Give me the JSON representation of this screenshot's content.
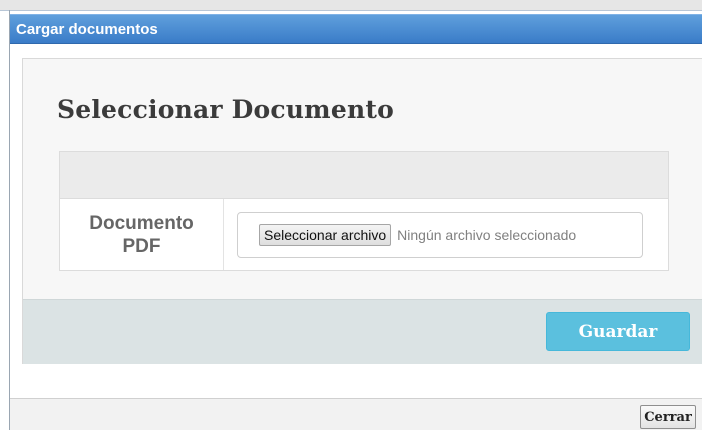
{
  "dialog": {
    "title": "Cargar documentos"
  },
  "card": {
    "title": "Seleccionar Documento",
    "field_label": "Documento PDF",
    "file_button_label": "Seleccionar archivo",
    "file_status": "Ningún archivo seleccionado",
    "save_label": "Guardar"
  },
  "footer": {
    "close_label": "Cerrar"
  },
  "colors": {
    "titlebar": "#3a7cc8",
    "save_button": "#5bc0de",
    "footer_band": "#dbe3e4"
  }
}
